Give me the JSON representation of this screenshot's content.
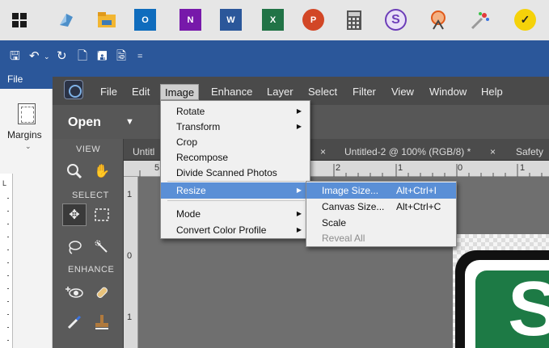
{
  "taskbar": {
    "icons": [
      {
        "name": "windows-start-icon",
        "color": "#1a1a1a"
      },
      {
        "name": "edge-icon",
        "color": "#3e7bb6"
      },
      {
        "name": "file-explorer-icon",
        "color": "#f2b632"
      },
      {
        "name": "outlook-icon",
        "color": "#0f6cbd"
      },
      {
        "name": "onenote-icon",
        "color": "#7719aa"
      },
      {
        "name": "word-icon",
        "color": "#2b579a"
      },
      {
        "name": "excel-icon",
        "color": "#217346"
      },
      {
        "name": "powerpoint-icon",
        "color": "#d24726"
      },
      {
        "name": "calculator-icon",
        "color": "#666666"
      },
      {
        "name": "s-app-icon",
        "color": "#6c3db8"
      },
      {
        "name": "snip-tool-icon",
        "color": "#e05a1a"
      },
      {
        "name": "paint-icon",
        "color": "#b0b0b0"
      },
      {
        "name": "norton-icon",
        "color": "#f5d20a"
      }
    ]
  },
  "word": {
    "file_tab": "File",
    "margins_label": "Margins",
    "ruler_corner": "L"
  },
  "pse": {
    "menu": [
      "File",
      "Edit",
      "Image",
      "Enhance",
      "Layer",
      "Select",
      "Filter",
      "View",
      "Window",
      "Help"
    ],
    "active_menu": "Image",
    "open_label": "Open",
    "panel_sections": {
      "view": "VIEW",
      "select": "SELECT",
      "enhance": "ENHANCE"
    },
    "doc_tabs": {
      "tab1": "Untitl",
      "tab2_close": "×",
      "tab3": "Untitled-2 @ 100% (RGB/8) *",
      "tab3_close": "×",
      "tab4": "Safety"
    },
    "ruler_h": [
      "5",
      "2",
      "1",
      "0",
      "1"
    ],
    "ruler_v": [
      "1",
      "0",
      "1"
    ],
    "sign_letter": "S"
  },
  "image_menu": {
    "items": [
      {
        "label": "Rotate",
        "submenu": true
      },
      {
        "label": "Transform",
        "submenu": true
      },
      {
        "label": "Crop",
        "submenu": false
      },
      {
        "label": "Recompose",
        "submenu": false
      },
      {
        "label": "Divide Scanned Photos",
        "submenu": false
      },
      {
        "label": "Resize",
        "submenu": true,
        "highlighted": true
      },
      {
        "label": "Mode",
        "submenu": true
      },
      {
        "label": "Convert Color Profile",
        "submenu": true
      }
    ]
  },
  "resize_menu": {
    "items": [
      {
        "label": "Image Size...",
        "shortcut": "Alt+Ctrl+I",
        "highlighted": true
      },
      {
        "label": "Canvas Size...",
        "shortcut": "Alt+Ctrl+C"
      },
      {
        "label": "Scale",
        "shortcut": ""
      },
      {
        "label": "Reveal All",
        "shortcut": "",
        "disabled": true
      }
    ]
  }
}
